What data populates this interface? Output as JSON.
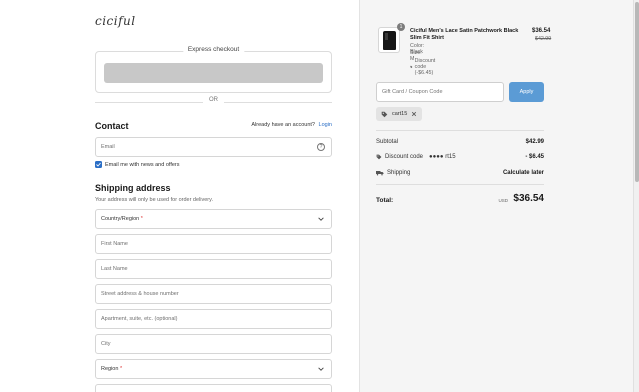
{
  "brand": {
    "logo_text": "ciciful"
  },
  "express": {
    "title": "Express checkout",
    "or_text": "OR"
  },
  "contact": {
    "title": "Contact",
    "login_prompt": "Already have an account?",
    "login_link": "Login",
    "email_placeholder": "Email",
    "news_label": "Email me with news and offers"
  },
  "shipping": {
    "title": "Shipping address",
    "note": "Your address will only be used for order delivery.",
    "country_label": "Country/Region",
    "first_name": "First Name",
    "last_name": "Last Name",
    "street": "Street address & house number",
    "apartment": "Apartment, suite, etc. (optional)",
    "city": "City",
    "region_label": "Region"
  },
  "cart": {
    "quantity": "1",
    "product_name": "Ciciful Men's Lace Satin Patchwork Black Slim Fit Shirt",
    "color": "Color: Black",
    "size": "Size: M",
    "discount": "Discount code (-$6.45)",
    "price": "$36.54",
    "old_price": "$42.99"
  },
  "coupon": {
    "placeholder": "Gift Card / Coupon Code",
    "apply_label": "Apply",
    "applied_code": "cart15"
  },
  "summary": {
    "subtotal_label": "Subtotal",
    "subtotal_value": "$42.99",
    "discount_label": "Discount code",
    "discount_code": "●●●● rt15",
    "discount_value": "- $6.45",
    "shipping_label": "Shipping",
    "shipping_value": "Calculate later",
    "total_label": "Total:",
    "currency": "USD",
    "total_value": "$36.54"
  },
  "colors": {
    "accent": "#2a6ec6",
    "apply_button": "#5b9bd5"
  }
}
